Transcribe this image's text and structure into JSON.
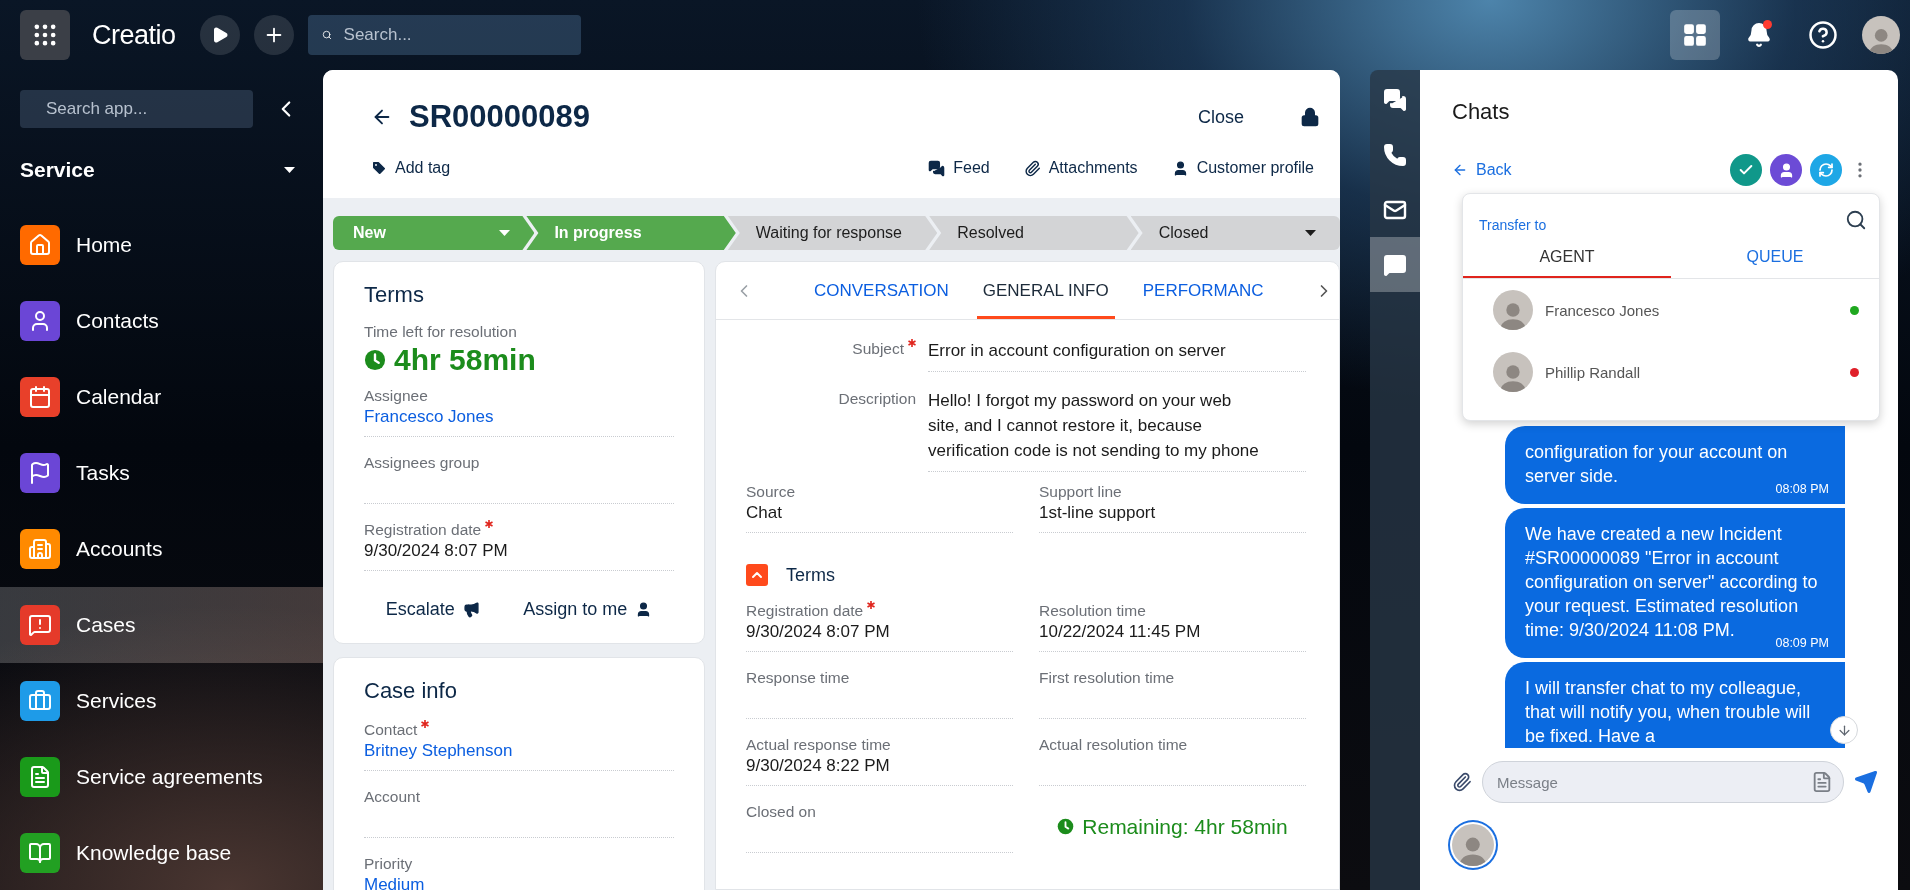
{
  "topbar": {
    "logo": "Creatio",
    "search": {
      "placeholder": "Search..."
    },
    "notifications": {
      "unread": true
    }
  },
  "sidebar": {
    "search": {
      "placeholder": "Search app..."
    },
    "workplace": "Service",
    "items": [
      {
        "label": "Home",
        "color": "#ff6a00",
        "selected": false
      },
      {
        "label": "Contacts",
        "color": "#6b46d6",
        "selected": false
      },
      {
        "label": "Calendar",
        "color": "#e8402a",
        "selected": false
      },
      {
        "label": "Tasks",
        "color": "#6b46d6",
        "selected": false
      },
      {
        "label": "Accounts",
        "color": "#ff8a00",
        "selected": false
      },
      {
        "label": "Cases",
        "color": "#e53a2a",
        "selected": true
      },
      {
        "label": "Services",
        "color": "#1e9be8",
        "selected": false
      },
      {
        "label": "Service agreements",
        "color": "#1a9a1a",
        "selected": false
      },
      {
        "label": "Knowledge base",
        "color": "#22a022",
        "selected": false
      }
    ]
  },
  "record": {
    "title": "SR00000089",
    "add_tag": "Add tag",
    "close": "Close",
    "header_links": [
      "Feed",
      "Attachments",
      "Customer profile"
    ],
    "stages": [
      {
        "label": "New",
        "completed": true,
        "dropdown": true
      },
      {
        "label": "In progress",
        "completed": true,
        "dropdown": false
      },
      {
        "label": "Waiting for response",
        "completed": false,
        "dropdown": false
      },
      {
        "label": "Resolved",
        "completed": false,
        "dropdown": false
      },
      {
        "label": "Closed",
        "completed": false,
        "dropdown": true
      }
    ],
    "terms_card": {
      "title": "Terms",
      "timer": {
        "label": "Time left for resolution",
        "value": "4hr 58min"
      },
      "fields": [
        {
          "label": "Assignee",
          "value": "Francesco Jones",
          "required": false,
          "link": true
        },
        {
          "label": "Assignees group",
          "required": false
        },
        {
          "label": "Registration date",
          "value": "9/30/2024 8:07 PM",
          "required": true,
          "link": false
        }
      ],
      "buttons": [
        "Escalate",
        "Assign to me"
      ]
    },
    "case_info_card": {
      "title": "Case info",
      "fields": [
        {
          "label": "Contact",
          "value": "Britney Stephenson",
          "required": true,
          "link": true
        },
        {
          "label": "Account",
          "required": false
        },
        {
          "label": "Priority",
          "value": "Medium",
          "required": false,
          "link": true
        }
      ]
    },
    "tabs": [
      {
        "label": "CONVERSATION",
        "selected": false
      },
      {
        "label": "GENERAL INFO",
        "selected": true
      },
      {
        "label": "PERFORMANC",
        "selected": false
      }
    ],
    "general_info": {
      "subject": {
        "label": "Subject",
        "value": "Error in account configuration on server",
        "required": true
      },
      "description": {
        "label": "Description",
        "value": "Hello! I forgot my password on your web site, and I cannot restore it, because verification code is not sending to my phone",
        "required": false
      },
      "fields": [
        {
          "label": "Source",
          "value": "Chat",
          "required": false
        },
        {
          "label": "Support line",
          "value": "1st-line support",
          "required": false
        }
      ],
      "terms_section": {
        "title": "Terms",
        "expanded": true,
        "fields": [
          {
            "label": "Registration date",
            "value": "9/30/2024 8:07 PM",
            "required": true
          },
          {
            "label": "Resolution time",
            "value": "10/22/2024 11:45 PM",
            "required": false
          },
          {
            "label": "Response time",
            "required": false
          },
          {
            "label": "First resolution time",
            "required": false
          },
          {
            "label": "Actual response time",
            "value": "9/30/2024 8:22 PM",
            "required": false
          },
          {
            "label": "Actual resolution time",
            "required": false
          },
          {
            "label": "Closed on",
            "required": false
          }
        ],
        "remaining": "Remaining: 4hr 58min"
      }
    }
  },
  "channels_rail": [
    {
      "selected": false
    },
    {
      "selected": false
    },
    {
      "selected": false
    },
    {
      "selected": true
    }
  ],
  "chats": {
    "title": "Chats",
    "back": "Back",
    "transfer": {
      "title": "Transfer to",
      "tabs": [
        {
          "label": "AGENT",
          "selected": true
        },
        {
          "label": "QUEUE",
          "selected": false
        }
      ],
      "agents": [
        {
          "name": "Francesco Jones",
          "color": "#1fa81f"
        },
        {
          "name": "Phillip Randall",
          "color": "#e0202a"
        }
      ]
    },
    "messages": [
      {
        "text": "configuration for your account on server side.",
        "time": "08:08 PM"
      },
      {
        "text": "We have created a new Incident #SR00000089 \"Error in account configuration on server\" according to your request. Estimated resolution time: 9/30/2024 11:08 PM.",
        "time": "08:09 PM"
      },
      {
        "text": "I will transfer chat to my colleague, that will notify you, when trouble will be fixed. Have a"
      }
    ],
    "composer": {
      "placeholder": "Message"
    }
  }
}
